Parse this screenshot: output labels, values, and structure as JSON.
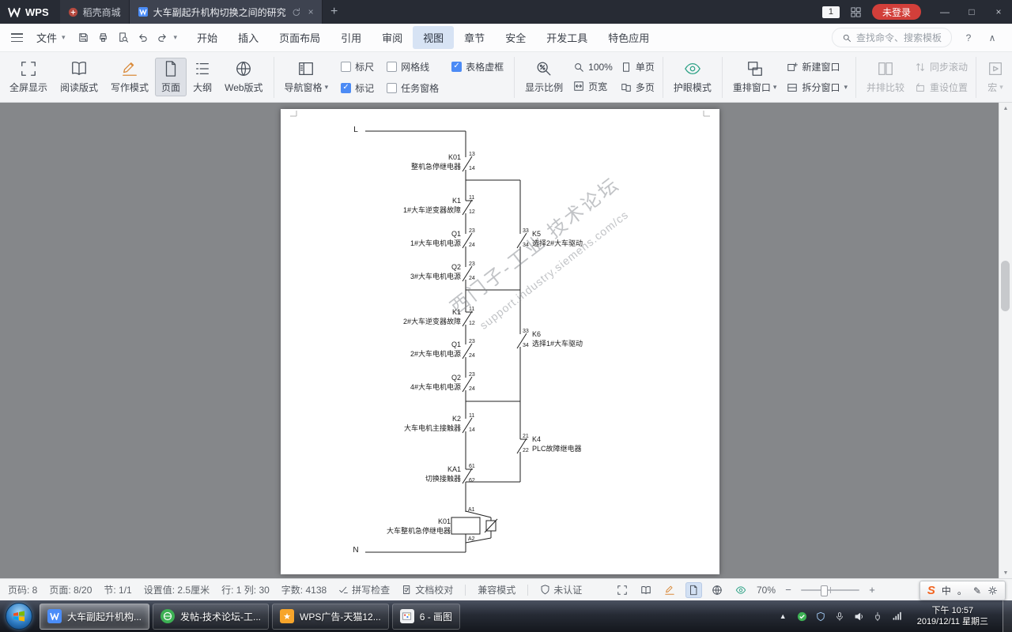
{
  "icons": {
    "caret": "▾",
    "check": "✓",
    "close": "×",
    "minimize": "—",
    "maximize": "□",
    "plus": "+",
    "minus": "−",
    "help": "?",
    "collapse": "∧",
    "arrow_up": "▲",
    "arrow_down": "▼",
    "star": "★",
    "ime_dot": "。",
    "ime_pen": "✎"
  },
  "titlebar": {
    "app": "WPS",
    "tab_docer": "稻壳商城",
    "tab_doc": "大车副起升机构切换之间的研究",
    "badge": "1",
    "login": "未登录"
  },
  "menubar": {
    "file": "文件",
    "items": [
      "开始",
      "插入",
      "页面布局",
      "引用",
      "审阅",
      "视图",
      "章节",
      "安全",
      "开发工具",
      "特色应用"
    ],
    "search": "查找命令、搜索模板"
  },
  "ribbon": {
    "fullscreen": "全屏显示",
    "reading": "阅读版式",
    "writing": "写作模式",
    "page_mode": "页面",
    "outline": "大纲",
    "web_layout": "Web版式",
    "nav_pane": "导航窗格",
    "ruler": "标尺",
    "gridlines": "网格线",
    "table_border": "表格虚框",
    "markup": "标记",
    "task_pane": "任务窗格",
    "zoom_ratio": "显示比例",
    "zoom_100": "100%",
    "page_width": "页宽",
    "single_page": "单页",
    "multi_page": "多页",
    "eye_mode": "护眼模式",
    "rearrange": "重排窗口",
    "new_window": "新建窗口",
    "split_window": "拆分窗口",
    "side_compare": "并排比较",
    "sync_scroll": "同步滚动",
    "reset_position": "重设位置",
    "macro": "宏"
  },
  "diagram": {
    "rail_l": "L",
    "rail_n": "N",
    "watermark1": "西门子-工业 技术论坛",
    "watermark2": "support.industry.siemens.com/cs",
    "main_contacts": [
      {
        "name": "K01",
        "desc": "整机急停继电器",
        "t1": "13",
        "t2": "14"
      },
      {
        "name": "K1",
        "desc": "1#大车逆变器故障",
        "t1": "11",
        "t2": "12"
      },
      {
        "name": "Q1",
        "desc": "1#大车电机电源",
        "t1": "23",
        "t2": "24"
      },
      {
        "name": "Q2",
        "desc": "3#大车电机电源",
        "t1": "23",
        "t2": "24"
      },
      {
        "name": "K1",
        "desc": "2#大车逆变器故障",
        "t1": "11",
        "t2": "12"
      },
      {
        "name": "Q1",
        "desc": "2#大车电机电源",
        "t1": "23",
        "t2": "24"
      },
      {
        "name": "Q2",
        "desc": "4#大车电机电源",
        "t1": "23",
        "t2": "24"
      },
      {
        "name": "K2",
        "desc": "大车电机主接触器",
        "t1": "11",
        "t2": "14"
      },
      {
        "name": "KA1",
        "desc": "切换接触器",
        "t1": "61",
        "t2": "62"
      }
    ],
    "branch_contacts": [
      {
        "name": "K5",
        "desc": "选择2#大车驱动",
        "t1": "33",
        "t2": "34"
      },
      {
        "name": "K6",
        "desc": "选择1#大车驱动",
        "t1": "33",
        "t2": "34"
      },
      {
        "name": "K4",
        "desc": "PLC故障继电器",
        "t1": "21",
        "t2": "22"
      }
    ],
    "coil": {
      "name": "K01",
      "desc": "大车整机急停继电器",
      "t1": "A1",
      "t2": "A2"
    }
  },
  "statusbar": {
    "page_no": "页码: 8",
    "pages": "页面: 8/20",
    "section": "节: 1/1",
    "setting": "设置值: 2.5厘米",
    "row_col": "行: 1 列: 30",
    "word_count": "字数: 4138",
    "spell_check": "拼写检查",
    "doc_proof": "文档校对",
    "compat_mode": "兼容模式",
    "not_certified": "未认证",
    "zoom_level": "70%"
  },
  "ime": {
    "logo": "S",
    "lang": "中"
  },
  "taskbar": {
    "tasks": [
      {
        "label": "大车副起升机构..."
      },
      {
        "label": "发帖-技术论坛-工..."
      },
      {
        "label": "WPS广告-天猫12..."
      },
      {
        "label": "6 - 画图"
      }
    ],
    "time": "下午 10:57",
    "date": "2019/12/11 星期三"
  }
}
